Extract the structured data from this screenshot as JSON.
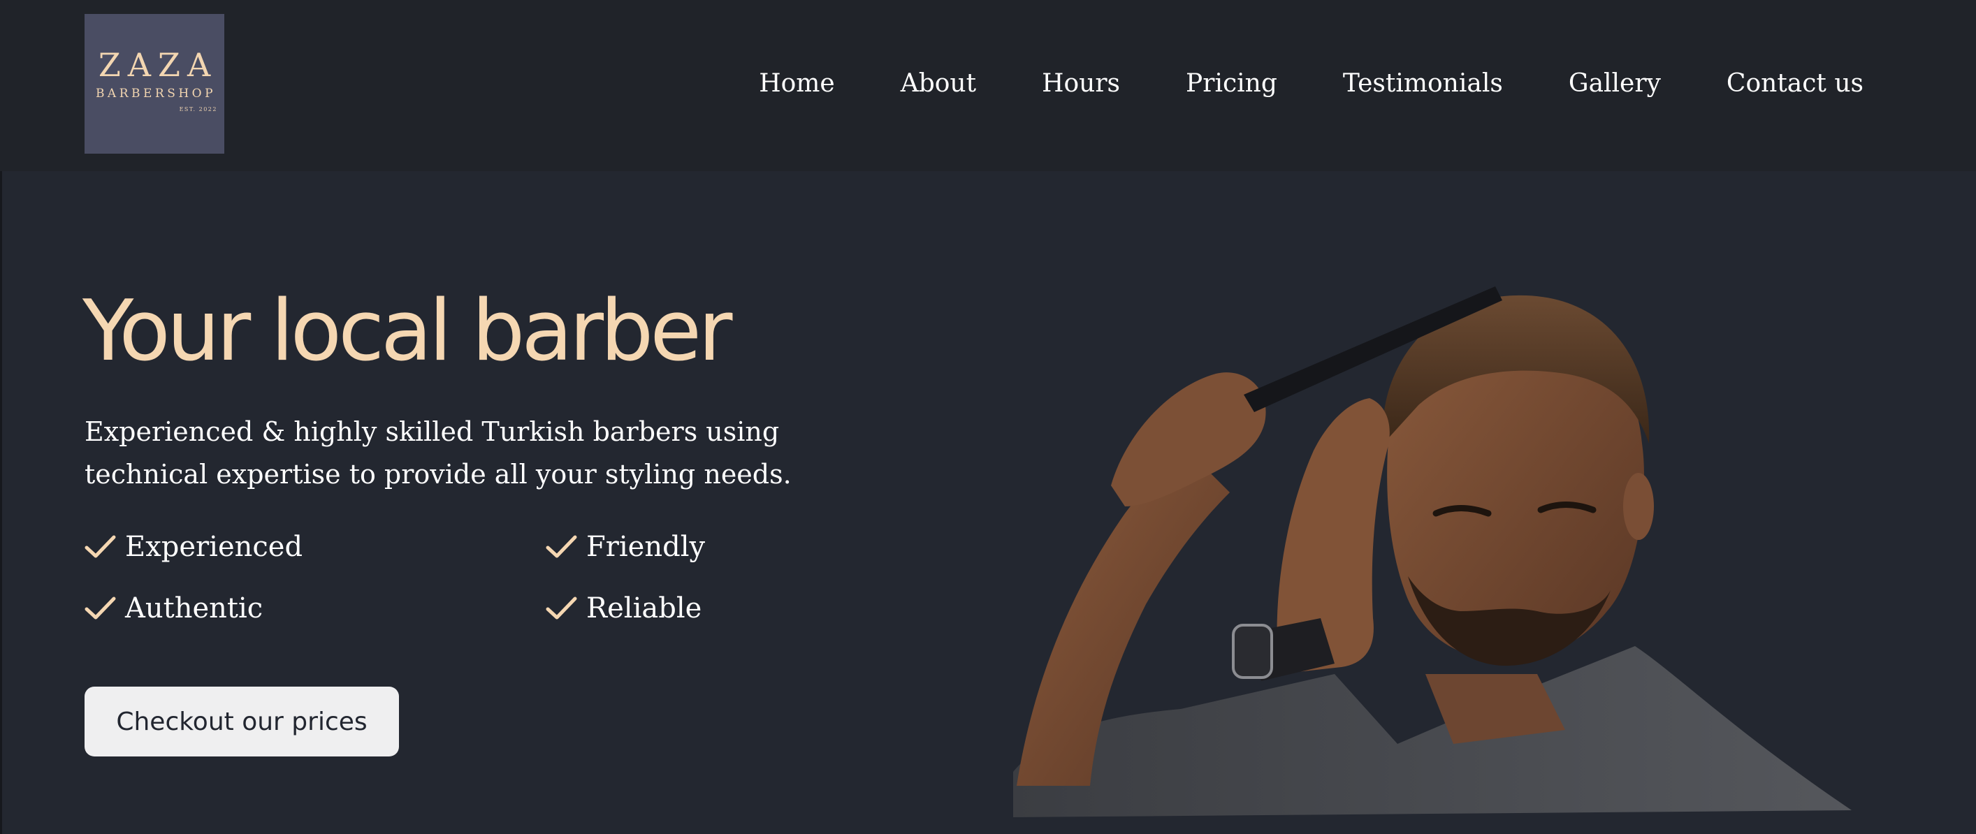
{
  "logo": {
    "name": "ZAZA",
    "subtitle": "BARBERSHOP",
    "est": "EST. 2022"
  },
  "nav": {
    "items": [
      "Home",
      "About",
      "Hours",
      "Pricing",
      "Testimonials",
      "Gallery",
      "Contact us"
    ]
  },
  "hero": {
    "title": "Your local barber",
    "description": "Experienced & highly skilled Turkish barbers using technical expertise to provide all your styling needs.",
    "features": [
      "Experienced",
      "Friendly",
      "Authentic",
      "Reliable"
    ],
    "cta_label": "Checkout our prices",
    "image_subject": "man combing his hair"
  },
  "colors": {
    "background": "#232730",
    "header": "#202329",
    "accent": "#f5d7b2",
    "logo_bg": "#4a4d63",
    "button_bg": "#efeff0",
    "text": "#ffffff"
  },
  "icons": {
    "feature_bullet": "check-icon"
  }
}
